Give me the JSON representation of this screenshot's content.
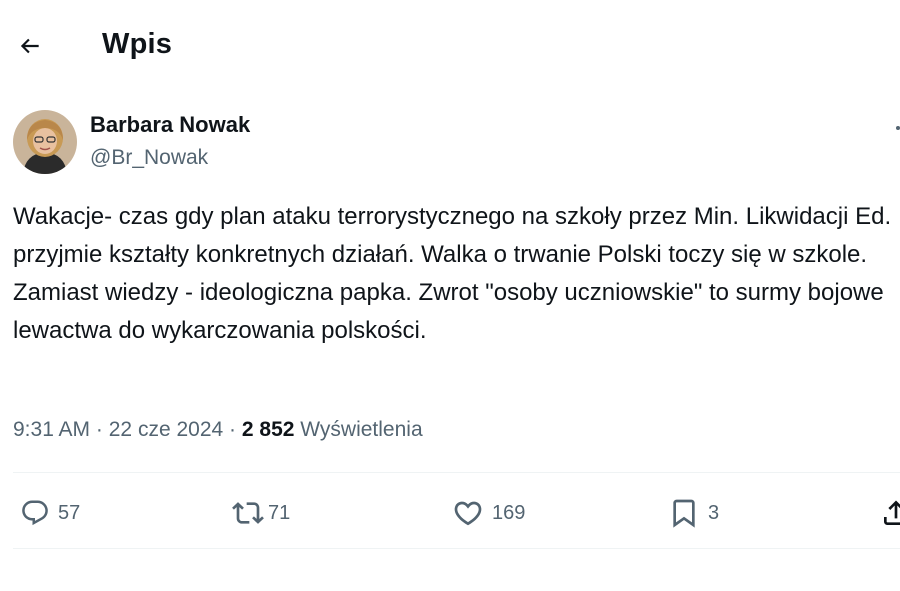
{
  "header": {
    "back_icon": "arrow-left-icon",
    "title": "Wpis"
  },
  "tweet": {
    "author": {
      "name": "Barbara Nowak",
      "handle": "@Br_Nowak",
      "avatar_icon": "profile-photo"
    },
    "text": "Wakacje- czas gdy plan ataku terrorystycznego na szkoły przez Min. Likwidacji Ed. przyjmie kształty konkretnych działań. Walka o trwanie Polski toczy się w szkole. Zamiast wiedzy - ideologiczna papka. Zwrot \"osoby uczniowskie\" to surmy bojowe lewactwa do wykarczowania polskości.",
    "time": "9:31 AM",
    "separator": "·",
    "date": "22 cze 2024",
    "views_count": "2 852",
    "views_label": "Wyświetlenia"
  },
  "actions": {
    "reply": {
      "icon": "reply-icon",
      "count": "57"
    },
    "retweet": {
      "icon": "retweet-icon",
      "count": "71"
    },
    "like": {
      "icon": "heart-icon",
      "count": "169"
    },
    "bookmark": {
      "icon": "bookmark-icon",
      "count": "3"
    },
    "share": {
      "icon": "share-icon"
    }
  },
  "colors": {
    "text_primary": "#0f1419",
    "text_secondary": "#536471",
    "divider": "#eff3f4"
  }
}
